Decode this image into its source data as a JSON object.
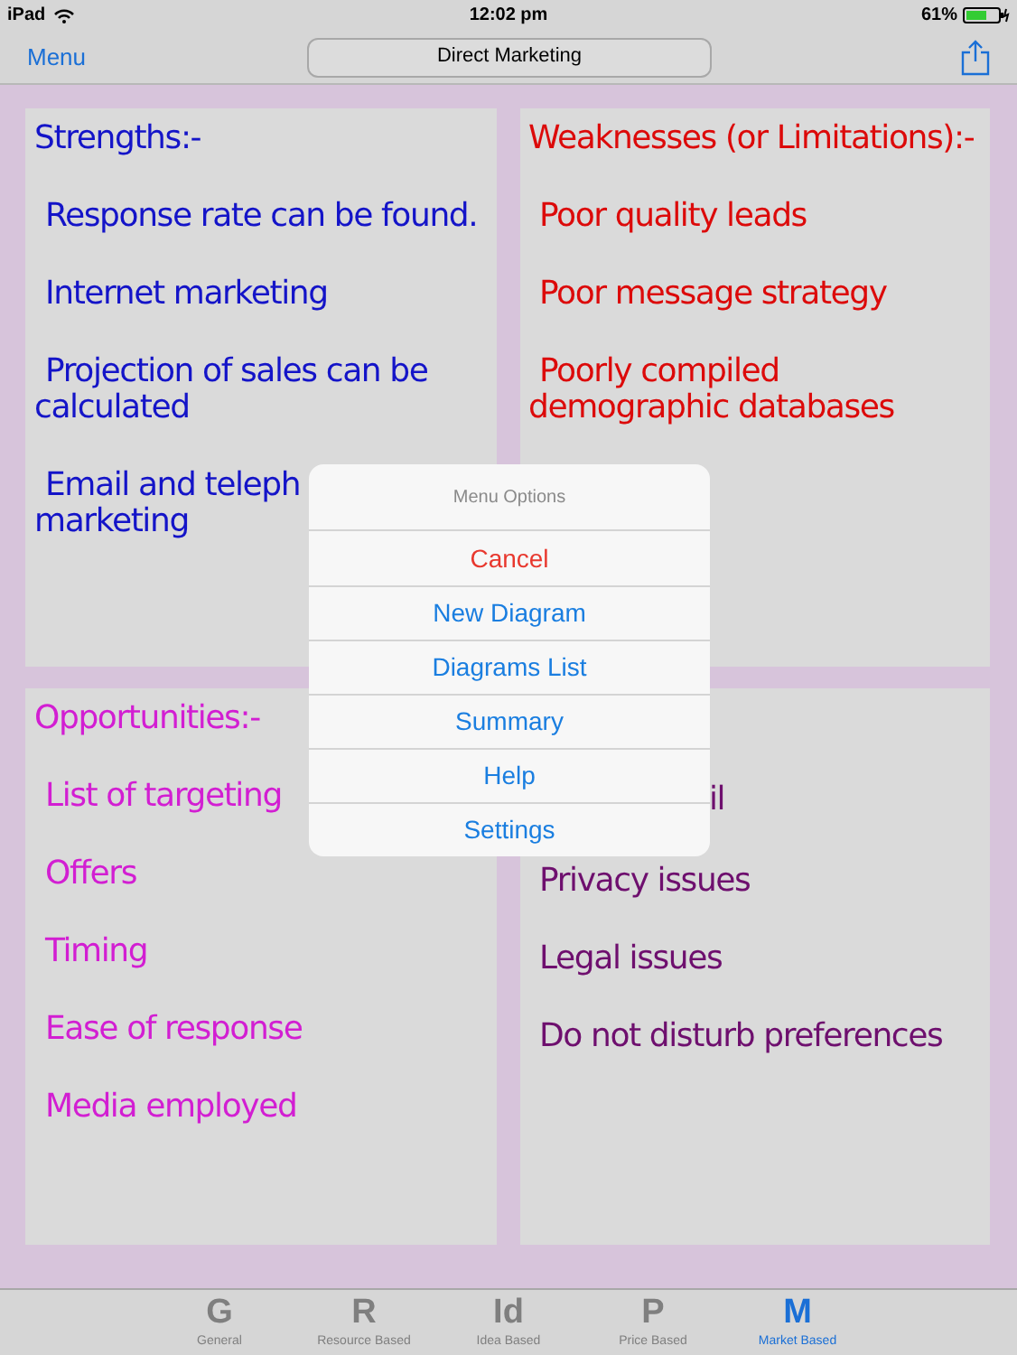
{
  "status_bar": {
    "device": "iPad",
    "time": "12:02 pm",
    "battery": "61%"
  },
  "nav_bar": {
    "menu": "Menu",
    "title": "Direct Marketing"
  },
  "quadrants": [
    {
      "kind": "strengths",
      "title": "Strengths:-",
      "items": [
        {
          "kind": "text",
          "text": "Response rate can be found."
        },
        {
          "kind": "text",
          "text": "Internet marketing"
        },
        {
          "kind": "text",
          "text": "Projection of sales can be calculated"
        },
        {
          "kind": "lines",
          "lines": [
            "Email and teleph",
            "marketing"
          ]
        }
      ]
    },
    {
      "kind": "weaknesses",
      "title": "Weaknesses (or Limitations):-",
      "items": [
        {
          "kind": "text",
          "text": "Poor quality leads"
        },
        {
          "kind": "text",
          "text": "Poor message strategy"
        },
        {
          "kind": "text",
          "text": "Poorly compiled demographic databases"
        }
      ]
    },
    {
      "kind": "opportunities",
      "title": "Opportunities:-",
      "items": [
        {
          "kind": "text",
          "text": "List of targeting"
        },
        {
          "kind": "text",
          "text": "Offers"
        },
        {
          "kind": "text",
          "text": "Timing"
        },
        {
          "kind": "text",
          "text": "Ease of response"
        },
        {
          "kind": "text",
          "text": "Media employed"
        }
      ]
    },
    {
      "kind": "threats",
      "items": [
        {
          "kind": "fragment",
          "text": "il"
        },
        {
          "kind": "text",
          "text": "Privacy issues"
        },
        {
          "kind": "text",
          "text": "Legal issues"
        },
        {
          "kind": "text",
          "text": "Do not disturb preferences"
        }
      ]
    }
  ],
  "menu_popup": {
    "title": "Menu Options",
    "options": [
      {
        "kind": "destructive",
        "label": "Cancel"
      },
      {
        "kind": "default",
        "label": "New Diagram"
      },
      {
        "kind": "default",
        "label": "Diagrams List"
      },
      {
        "kind": "default",
        "label": "Summary"
      },
      {
        "kind": "default",
        "label": "Help"
      },
      {
        "kind": "default",
        "label": "Settings"
      }
    ]
  },
  "tab_bar": [
    {
      "glyph": "G",
      "label": "General",
      "selected": false
    },
    {
      "glyph": "R",
      "label": "Resource Based",
      "selected": false
    },
    {
      "glyph": "Id",
      "label": "Idea Based",
      "selected": false
    },
    {
      "glyph": "P",
      "label": "Price Based",
      "selected": false
    },
    {
      "glyph": "M",
      "label": "Market Based",
      "selected": true
    }
  ]
}
